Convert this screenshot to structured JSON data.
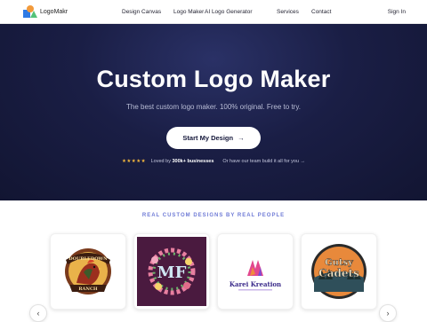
{
  "brand": {
    "name": "LogoMakr"
  },
  "nav": {
    "links": [
      "Design Canvas",
      "Logo Maker",
      "AI Logo Generator",
      "Services",
      "Contact"
    ],
    "sign_in": "Sign In"
  },
  "hero": {
    "title": "Custom Logo Maker",
    "subtitle": "The best custom logo maker. 100% original. Free to try.",
    "cta_label": "Start My Design",
    "cta_arrow": "→",
    "rating_stars": "★★★★★",
    "loved_prefix": "Loved by",
    "loved_count": "300k+ businesses",
    "team_link": "Or have our team build it all for you →"
  },
  "showcase": {
    "label": "REAL CUSTOM DESIGNS BY REAL PEOPLE",
    "cards": [
      {
        "top_text": "DOUBLEDOWN",
        "bottom_text": "RANCH"
      },
      {
        "text": "MF"
      },
      {
        "text": "Karei Kreation"
      },
      {
        "line1": "Gutsy",
        "line2": "Cadets"
      }
    ],
    "prev_icon": "‹",
    "next_icon": "›"
  }
}
